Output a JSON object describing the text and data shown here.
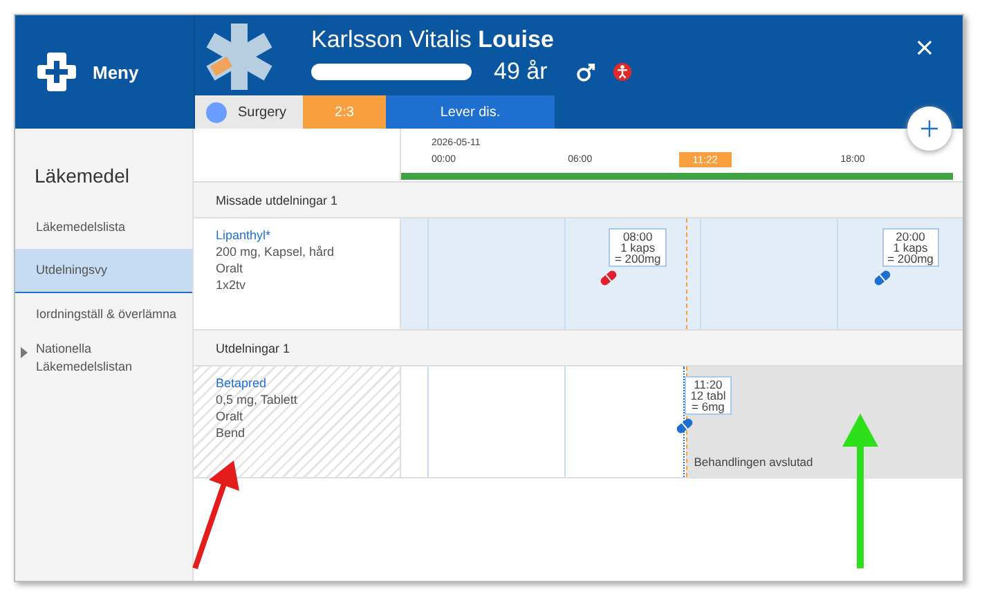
{
  "menu": {
    "label": "Meny"
  },
  "patient": {
    "name": "Karlsson Vitalis **Louise**",
    "age": "49 år"
  },
  "tags": [
    {
      "label": "Surgery",
      "kind": "unit",
      "color": "#6b9cff"
    },
    {
      "label": "2:3",
      "kind": "room"
    },
    {
      "label": "Lever dis.",
      "kind": "diagnosis"
    }
  ],
  "sidebar": {
    "title": "Läkemedel",
    "items": [
      {
        "label": "Läkemedelslista",
        "selected": false,
        "expandable": false
      },
      {
        "label": "Utdelningsvy",
        "selected": true,
        "expandable": false
      },
      {
        "label": "Iordningställ & överlämna",
        "selected": false,
        "expandable": false
      },
      {
        "label": "Nationella Läkemedelslistan",
        "selected": false,
        "expandable": true
      }
    ]
  },
  "timeline": {
    "date": "2026-05-11",
    "ticks": [
      "00:00",
      "06:00",
      "18:00"
    ],
    "now": "11:22"
  },
  "sections": [
    {
      "title": "Missade utdelningar 1",
      "kind": "missed",
      "rows": [
        {
          "name": "Lipanthyl*",
          "lines": [
            "200 mg, Kapsel, hård",
            "Oralt",
            "1x2tv"
          ],
          "ended": false,
          "doses": [
            {
              "time": "08:00",
              "amount": "1 kaps",
              "total": "= 200mg",
              "color": "#e0202a",
              "kind": "planned"
            },
            {
              "time": "20:00",
              "amount": "1 kaps",
              "total": "= 200mg",
              "color": "#1e6fd0",
              "kind": "planned"
            }
          ]
        }
      ]
    },
    {
      "title": "Utdelningar 1",
      "kind": "given",
      "rows": [
        {
          "name": "Betapred",
          "lines": [
            "0,5 mg, Tablett",
            "Oralt",
            "Bend"
          ],
          "ended": true,
          "ended_label": "Behandlingen avslutad",
          "doses": [
            {
              "time": "11:20",
              "amount": "12 tabl",
              "total": "= 6mg",
              "color": "#1e6fd0",
              "kind": "given"
            }
          ]
        }
      ]
    }
  ]
}
